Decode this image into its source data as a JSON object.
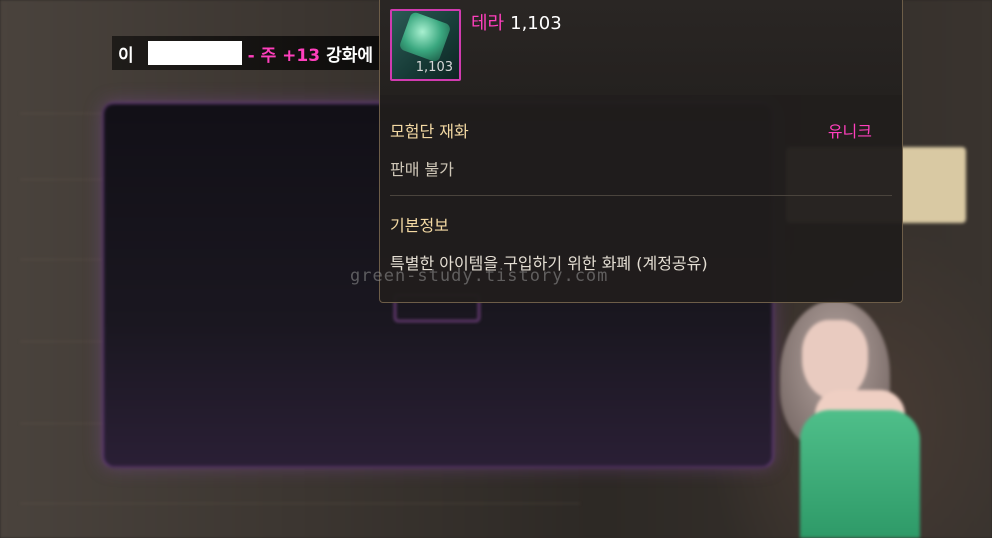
{
  "notice": {
    "prefix": "이",
    "enhance": "- 주 +13",
    "message": "강화에 성공하였습니다."
  },
  "tooltip": {
    "item_name": "테라",
    "item_amount": "1,103",
    "icon_count": "1,103",
    "item_type": "모험단 재화",
    "rarity": "유니크",
    "trade": "판매 불가",
    "section_title": "기본정보",
    "description": "특별한 아이템을 구입하기 위한 화폐 (계정공유)"
  },
  "watermark": "green-study.tistory.com",
  "colors": {
    "rarity_unique": "#ff3fbd",
    "label_gold": "#f3d9a3",
    "tooltip_bg": "#201d1c"
  }
}
